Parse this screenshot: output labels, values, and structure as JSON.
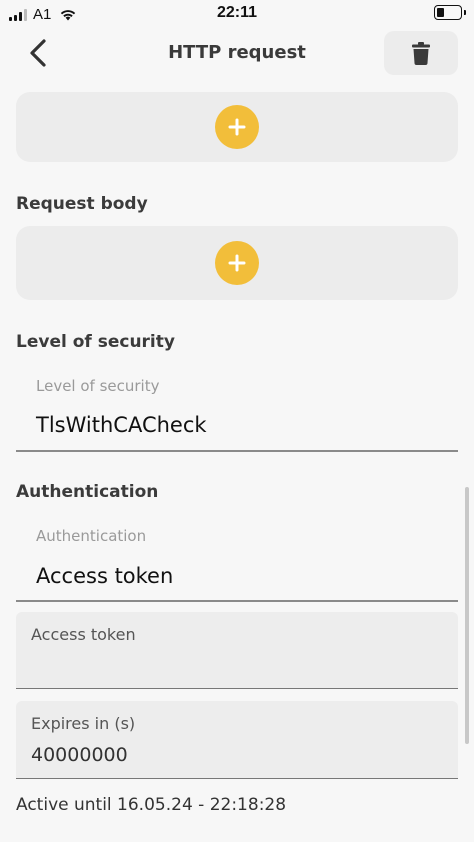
{
  "status_bar": {
    "carrier": "A1",
    "time": "22:11"
  },
  "header": {
    "title": "HTTP request"
  },
  "icons": {
    "back": "chevron-left-icon",
    "delete": "trash-icon",
    "add": "plus-icon",
    "wifi": "wifi-icon",
    "battery": "battery-icon",
    "signal": "signal-icon"
  },
  "colors": {
    "accent": "#f2be3a",
    "card": "#ececec",
    "background": "#f7f7f7"
  },
  "sections": {
    "request_body": {
      "title": "Request body"
    },
    "security": {
      "title": "Level of security",
      "field_label": "Level of security",
      "field_value": "TlsWithCACheck"
    },
    "authentication": {
      "title": "Authentication",
      "field_label": "Authentication",
      "field_value": "Access token"
    }
  },
  "access_token": {
    "label": "Access token",
    "value": ""
  },
  "expires": {
    "label": "Expires in (s)",
    "value": "40000000"
  },
  "active_until": "Active until 16.05.24 - 22:18:28"
}
